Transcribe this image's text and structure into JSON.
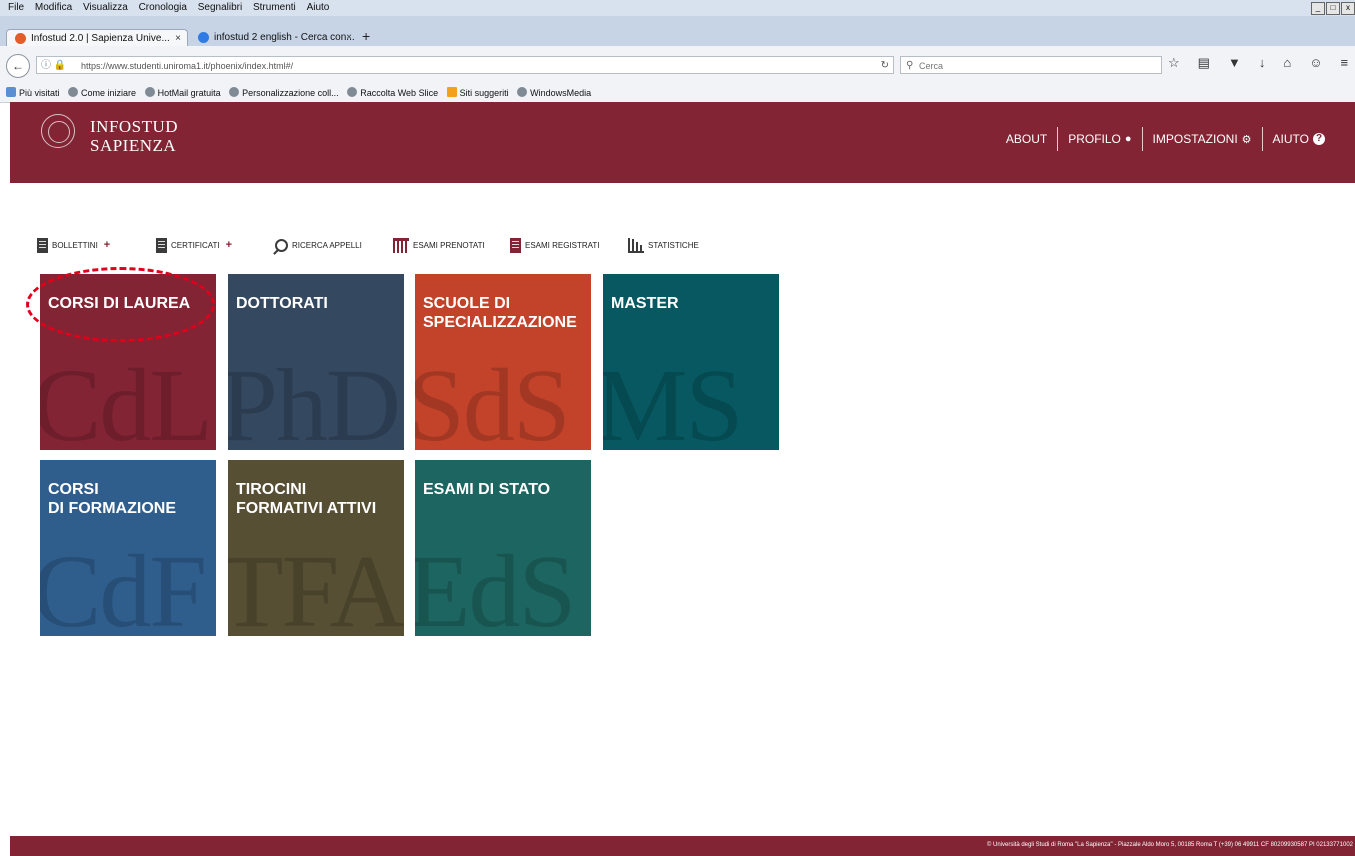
{
  "browser": {
    "menu": [
      "File",
      "Modifica",
      "Visualizza",
      "Cronologia",
      "Segnalibri",
      "Strumenti",
      "Aiuto"
    ],
    "tabs": [
      {
        "title": "Infostud 2.0 | Sapienza Unive...",
        "close": "×"
      },
      {
        "title": "infostud 2 english - Cerca con...",
        "close": "×"
      }
    ],
    "new_tab": "+",
    "url": "https://www.studenti.uniroma1.it/phoenix/index.html#/",
    "search_placeholder": "Cerca",
    "bookmarks": [
      "Più visitati",
      "Come iniziare",
      "HotMail gratuita",
      "Personalizzazione coll...",
      "Raccolta Web Slice",
      "Siti suggeriti",
      "WindowsMedia"
    ]
  },
  "header": {
    "brand_line1": "INFOSTUD",
    "brand_line2": "SAPIENZA",
    "nav": {
      "about": "ABOUT",
      "profilo": "PROFILO",
      "impostazioni": "IMPOSTAZIONI",
      "aiuto": "AIUTO"
    }
  },
  "quickbar": {
    "bollettini": "BOLLETTINI",
    "certificati": "CERTIFICATI",
    "ricerca_appelli": "RICERCA APPELLI",
    "esami_prenotati": "ESAMI PRENOTATI",
    "esami_registrati": "ESAMI REGISTRATI",
    "statistiche": "STATISTICHE"
  },
  "tiles": [
    {
      "label": "CORSI DI LAUREA",
      "bg": "CdL",
      "color": "#822433"
    },
    {
      "label": "DOTTORATI",
      "bg": "PhD",
      "color": "#344860"
    },
    {
      "label": "SCUOLE DI\nSPECIALIZZAZIONE",
      "bg": "SdS",
      "color": "#c2422a"
    },
    {
      "label": "MASTER",
      "bg": "MS",
      "color": "#075861"
    },
    {
      "label": "CORSI\nDI FORMAZIONE",
      "bg": "CdF",
      "color": "#2f5e8d"
    },
    {
      "label": "TIROCINI\nFORMATIVI ATTIVI",
      "bg": "TFA",
      "color": "#574f34"
    },
    {
      "label": "ESAMI DI STATO",
      "bg": "EdS",
      "color": "#1d6560"
    }
  ],
  "footer": {
    "text": "© Università degli Studi di Roma \"La Sapienza\" - Piazzale Aldo Moro 5, 00185 Roma T (+39) 06 49911 CF 80209930587 PI 02133771002"
  },
  "colors": {
    "brand": "#822433",
    "highlight": "#e0001b"
  }
}
